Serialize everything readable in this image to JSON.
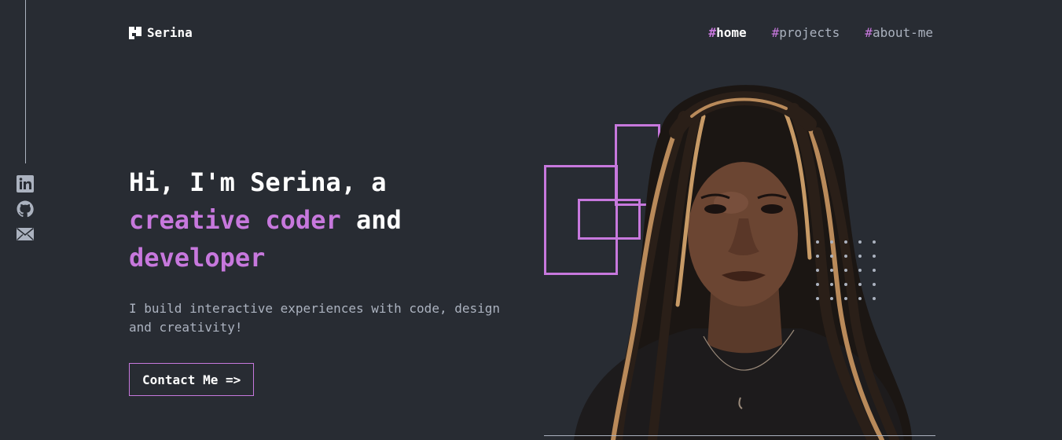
{
  "brand": {
    "name": "Serina",
    "logo_icon": "logo-mark-icon"
  },
  "nav": {
    "items": [
      {
        "hash": "#",
        "label": "home",
        "active": true
      },
      {
        "hash": "#",
        "label": "projects",
        "active": false
      },
      {
        "hash": "#",
        "label": "about-me",
        "active": false
      }
    ]
  },
  "socials": [
    {
      "icon": "linkedin-icon"
    },
    {
      "icon": "github-icon"
    },
    {
      "icon": "mail-icon"
    }
  ],
  "hero": {
    "line1": "Hi, I'm Serina, a",
    "accent1": "creative coder",
    "and": " and",
    "accent2": "developer",
    "subtitle": "I build interactive experiences with code, design and creativity!",
    "cta": "Contact Me =>"
  },
  "colors": {
    "background": "#282c33",
    "accent": "#c778dd",
    "muted": "#abb2bf",
    "text": "#ffffff"
  }
}
